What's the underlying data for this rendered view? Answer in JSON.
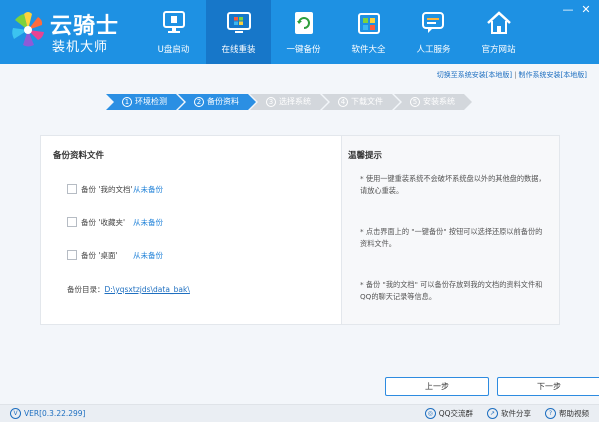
{
  "app": {
    "title": "云骑士",
    "subtitle": "装机大师"
  },
  "nav": [
    {
      "label": "U盘启动",
      "icon": "monitor-icon",
      "active": false
    },
    {
      "label": "在线重装",
      "icon": "windows-icon",
      "active": true
    },
    {
      "label": "一键备份",
      "icon": "backup-icon",
      "active": false
    },
    {
      "label": "软件大全",
      "icon": "software-icon",
      "active": false
    },
    {
      "label": "人工服务",
      "icon": "chat-icon",
      "active": false
    },
    {
      "label": "官方网站",
      "icon": "home-icon",
      "active": false
    }
  ],
  "window": {
    "minimize": "—",
    "close": "✕"
  },
  "links": {
    "switch_local": "切换至系统安装[本地版]",
    "separator": "|",
    "make_local": "制作系统安装[本地版]"
  },
  "steps": [
    {
      "num": "1",
      "label": "环境检测",
      "state": "done"
    },
    {
      "num": "2",
      "label": "备份资料",
      "state": "current"
    },
    {
      "num": "3",
      "label": "选择系统",
      "state": "todo"
    },
    {
      "num": "4",
      "label": "下载文件",
      "state": "todo"
    },
    {
      "num": "5",
      "label": "安装系统",
      "state": "todo"
    }
  ],
  "backup": {
    "title": "备份资料文件",
    "options": [
      {
        "label": "备份 '我的文档'",
        "status": "从未备份",
        "checked": false
      },
      {
        "label": "备份 '收藏夹'",
        "status": "从未备份",
        "checked": false
      },
      {
        "label": "备份 '桌面'",
        "status": "从未备份",
        "checked": false
      }
    ],
    "dir_label": "备份目录：",
    "dir_value": "D:\\yqsxtzjds\\data_bak\\"
  },
  "tips": {
    "title": "温馨提示",
    "items": [
      "* 使用一键重装系统不会破坏系统盘以外的其他盘的数据，请放心重装。",
      "* 点击界面上的 \"一键备份\" 按钮可以选择还原以前备份的资料文件。",
      "* 备份 \"我的文档\" 可以备份存放到我的文档的资料文件和QQ的聊天记录等信息。"
    ]
  },
  "buttons": {
    "prev": "上一步",
    "next": "下一步"
  },
  "footer": {
    "version": "VER[0.3.22.299]",
    "qq": "QQ交流群",
    "share": "软件分享",
    "help": "帮助视频"
  },
  "colors": {
    "primary": "#1e91e3",
    "nav_active": "#1777c9",
    "step_active": "#2b8fe3",
    "step_inactive": "#d3d7dc",
    "link": "#1e80d8"
  }
}
